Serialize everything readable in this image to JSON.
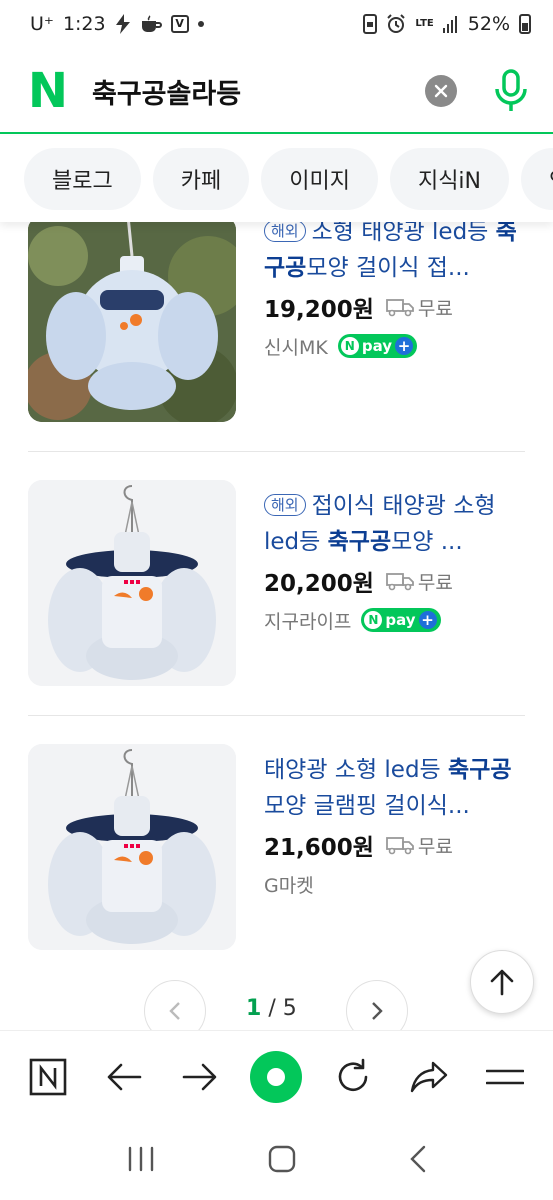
{
  "status_bar": {
    "carrier": "U⁺",
    "time": "1:23",
    "lte": "LTE",
    "battery": "52%"
  },
  "search": {
    "logo": "N",
    "query": "축구공솔라등",
    "clear_icon": "close-icon",
    "mic_icon": "mic-icon"
  },
  "tabs": [
    "블로그",
    "카페",
    "이미지",
    "지식iN",
    "인수"
  ],
  "products": [
    {
      "badge": "해외",
      "title_parts": [
        "소형 태양광 led등 ",
        "축구공",
        "모양 걸이식 접..."
      ],
      "price": "19,200원",
      "shipping": "무료",
      "seller": "신시MK",
      "npay": true
    },
    {
      "badge": "해외",
      "title_parts": [
        "접이식 태양광 소형 led등 ",
        "축구공",
        "모양 ..."
      ],
      "price": "20,200원",
      "shipping": "무료",
      "seller": "지구라이프",
      "npay": true
    },
    {
      "badge": "",
      "title_parts": [
        "태양광 소형 led등 ",
        "축구공",
        "모양 글램핑 걸이식..."
      ],
      "price": "21,600원",
      "shipping": "무료",
      "seller": "G마켓",
      "npay": false
    }
  ],
  "npay_label": "pay",
  "pagination": {
    "current": "1",
    "separator": "/",
    "total": "5"
  },
  "colors": {
    "brand_green": "#03c75a",
    "link_blue": "#1a4b9d"
  }
}
